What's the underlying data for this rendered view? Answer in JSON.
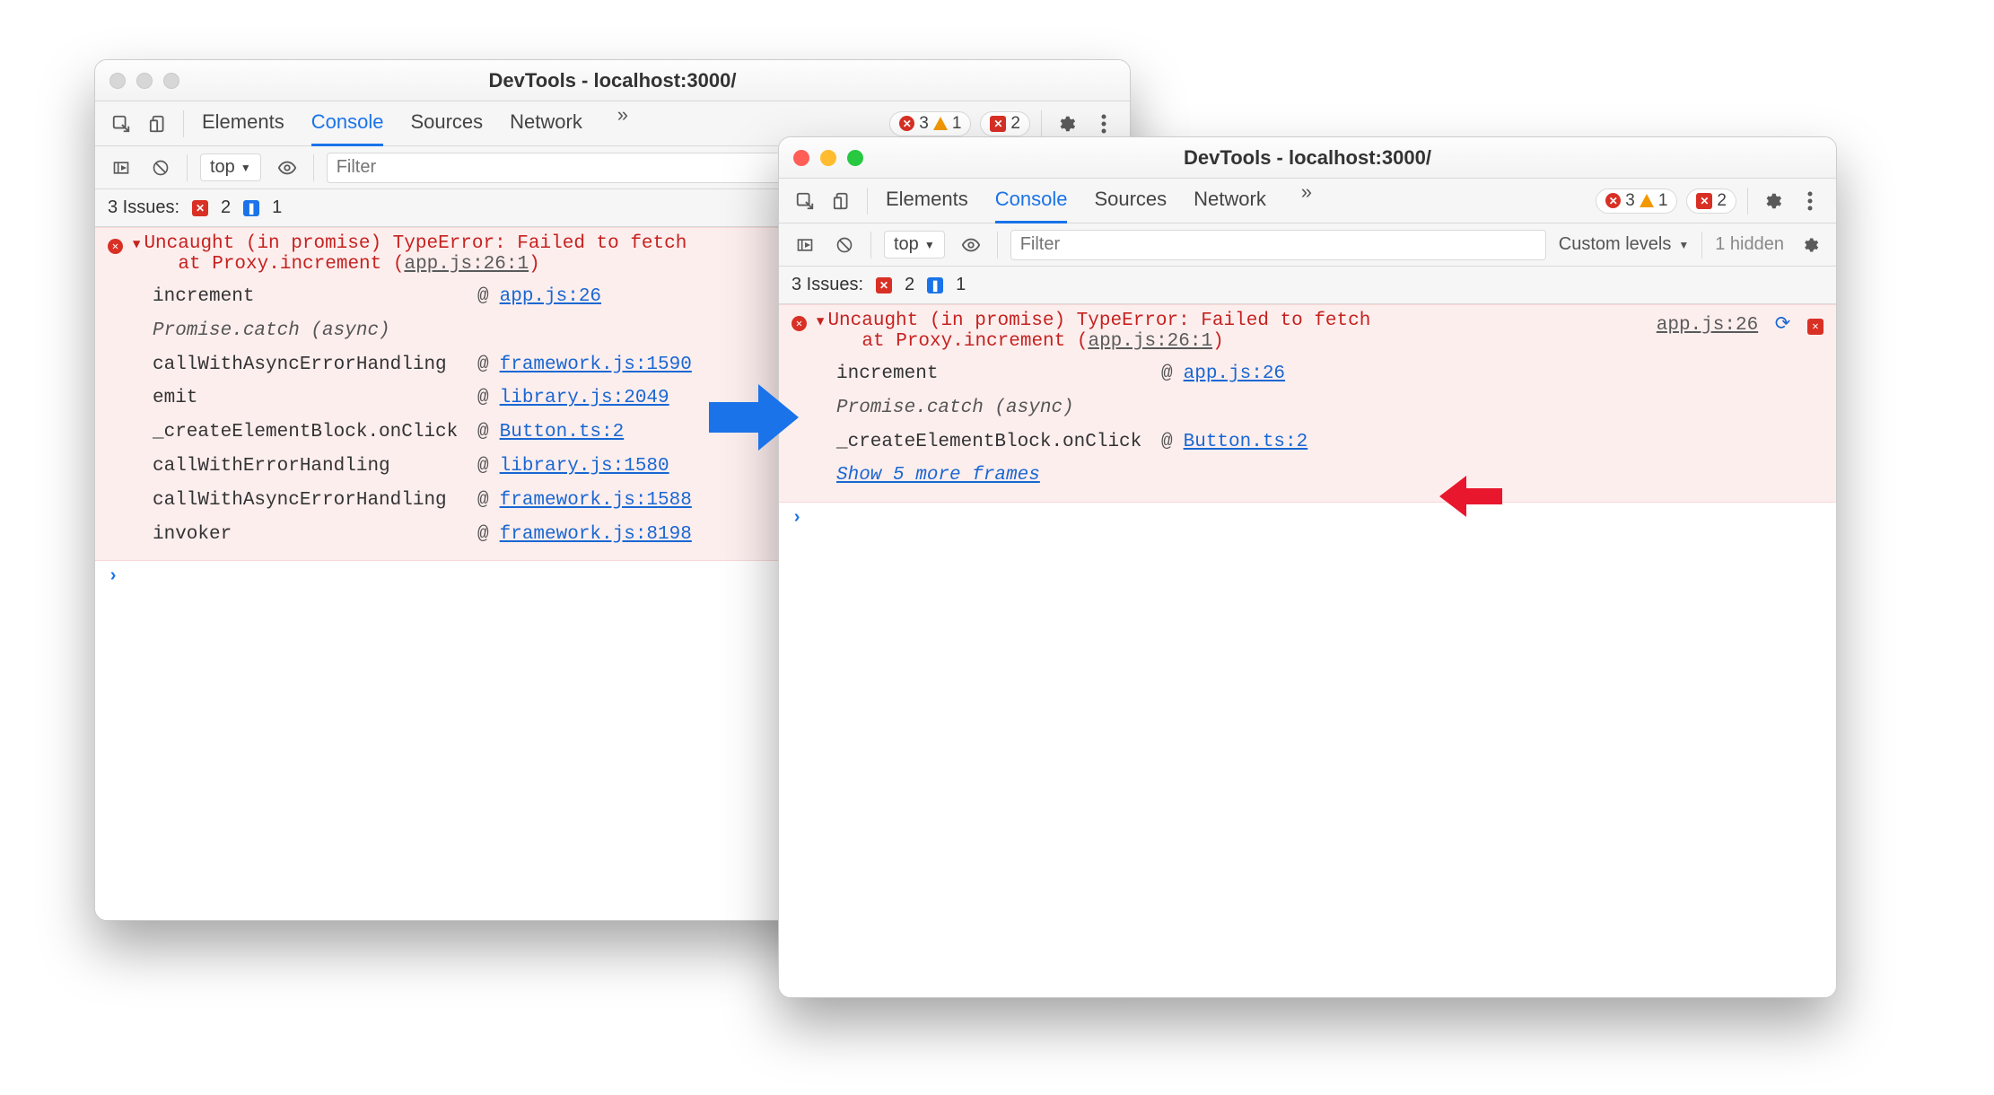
{
  "left": {
    "title": "DevTools - localhost:3000/",
    "tabs": {
      "elements": "Elements",
      "console": "Console",
      "sources": "Sources",
      "network": "Network"
    },
    "badges": {
      "errors": "3",
      "warnings": "1",
      "blocked": "2"
    },
    "filter": {
      "context": "top",
      "placeholder": "Filter"
    },
    "issues": {
      "label": "3 Issues:",
      "err": "2",
      "info": "1"
    },
    "error": {
      "head1": "Uncaught (in promise) TypeError: Failed to fetch",
      "head2_pre": "at Proxy.increment (",
      "head2_link": "app.js:26:1",
      "head2_post": ")",
      "stack": [
        {
          "fn": "increment",
          "at": "@",
          "loc": "app.js:26"
        },
        {
          "fn": "Promise.catch (async)",
          "italic": true
        },
        {
          "fn": "callWithAsyncErrorHandling",
          "at": "@",
          "loc": "framework.js:1590"
        },
        {
          "fn": "emit",
          "at": "@",
          "loc": "library.js:2049"
        },
        {
          "fn": "_createElementBlock.onClick",
          "at": "@",
          "loc": "Button.ts:2"
        },
        {
          "fn": "callWithErrorHandling",
          "at": "@",
          "loc": "library.js:1580"
        },
        {
          "fn": "callWithAsyncErrorHandling",
          "at": "@",
          "loc": "framework.js:1588"
        },
        {
          "fn": "invoker",
          "at": "@",
          "loc": "framework.js:8198"
        }
      ]
    }
  },
  "right": {
    "title": "DevTools - localhost:3000/",
    "tabs": {
      "elements": "Elements",
      "console": "Console",
      "sources": "Sources",
      "network": "Network"
    },
    "badges": {
      "errors": "3",
      "warnings": "1",
      "blocked": "2"
    },
    "filter": {
      "context": "top",
      "placeholder": "Filter",
      "levels": "Custom levels",
      "hidden": "1 hidden"
    },
    "issues": {
      "label": "3 Issues:",
      "err": "2",
      "info": "1"
    },
    "error": {
      "head1": "Uncaught (in promise) TypeError: Failed to fetch",
      "head2_pre": "at Proxy.increment (",
      "head2_link": "app.js:26:1",
      "head2_post": ")",
      "source_link": "app.js:26",
      "stack": [
        {
          "fn": "increment",
          "at": "@",
          "loc": "app.js:26"
        },
        {
          "fn": "Promise.catch (async)",
          "italic": true
        },
        {
          "fn": "_createElementBlock.onClick",
          "at": "@",
          "loc": "Button.ts:2"
        }
      ],
      "show_more": "Show 5 more frames"
    }
  }
}
